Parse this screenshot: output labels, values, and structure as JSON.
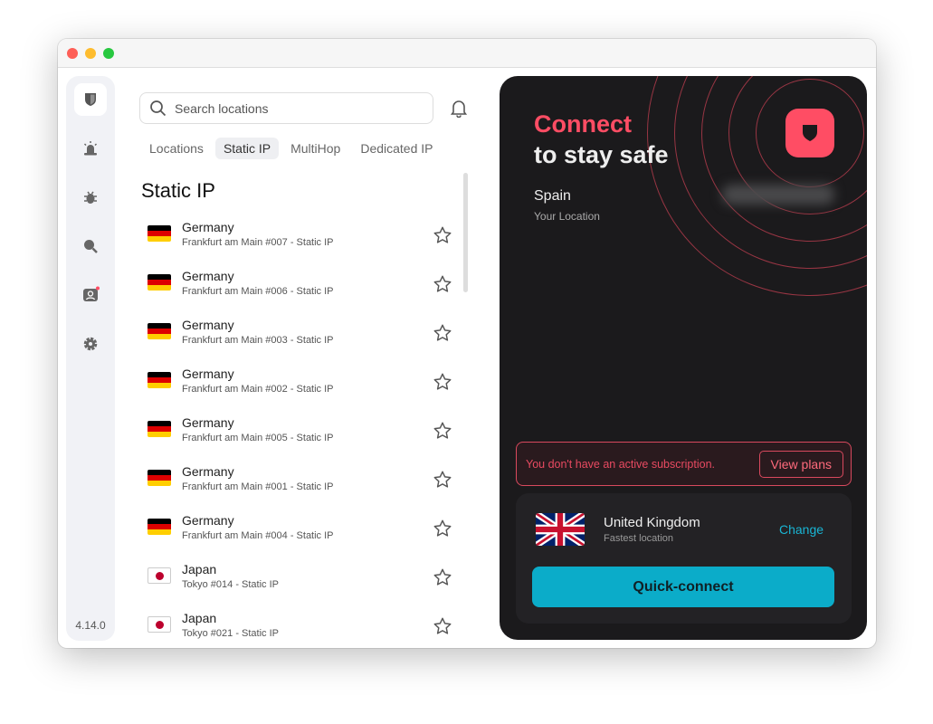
{
  "sidebar": {
    "version": "4.14.0",
    "icons": [
      "shield-icon",
      "alarm-icon",
      "bug-icon",
      "search-magnify-icon",
      "account-icon",
      "gear-icon"
    ]
  },
  "search": {
    "placeholder": "Search locations"
  },
  "tabs": [
    "Locations",
    "Static IP",
    "MultiHop",
    "Dedicated IP"
  ],
  "active_tab": "Static IP",
  "list": {
    "title": "Static IP",
    "items": [
      {
        "country": "Germany",
        "server": "Frankfurt am Main #007 - Static IP",
        "flag": "de"
      },
      {
        "country": "Germany",
        "server": "Frankfurt am Main #006 - Static IP",
        "flag": "de"
      },
      {
        "country": "Germany",
        "server": "Frankfurt am Main #003 - Static IP",
        "flag": "de"
      },
      {
        "country": "Germany",
        "server": "Frankfurt am Main #002 - Static IP",
        "flag": "de"
      },
      {
        "country": "Germany",
        "server": "Frankfurt am Main #005 - Static IP",
        "flag": "de"
      },
      {
        "country": "Germany",
        "server": "Frankfurt am Main #001 - Static IP",
        "flag": "de"
      },
      {
        "country": "Germany",
        "server": "Frankfurt am Main #004 - Static IP",
        "flag": "de"
      },
      {
        "country": "Japan",
        "server": "Tokyo #014 - Static IP",
        "flag": "jp"
      },
      {
        "country": "Japan",
        "server": "Tokyo #021 - Static IP",
        "flag": "jp"
      }
    ]
  },
  "panel": {
    "title_accent": "Connect",
    "title_rest": "to stay safe",
    "location": "Spain",
    "location_label": "Your Location",
    "alert": "You don't have an active subscription.",
    "view_plans": "View plans",
    "server_country": "United Kingdom",
    "server_sub": "Fastest location",
    "change": "Change",
    "quick_connect": "Quick-connect"
  },
  "colors": {
    "accent": "#ff4d64",
    "cyan": "#0bacc9",
    "panel_bg": "#1b1a1c"
  }
}
